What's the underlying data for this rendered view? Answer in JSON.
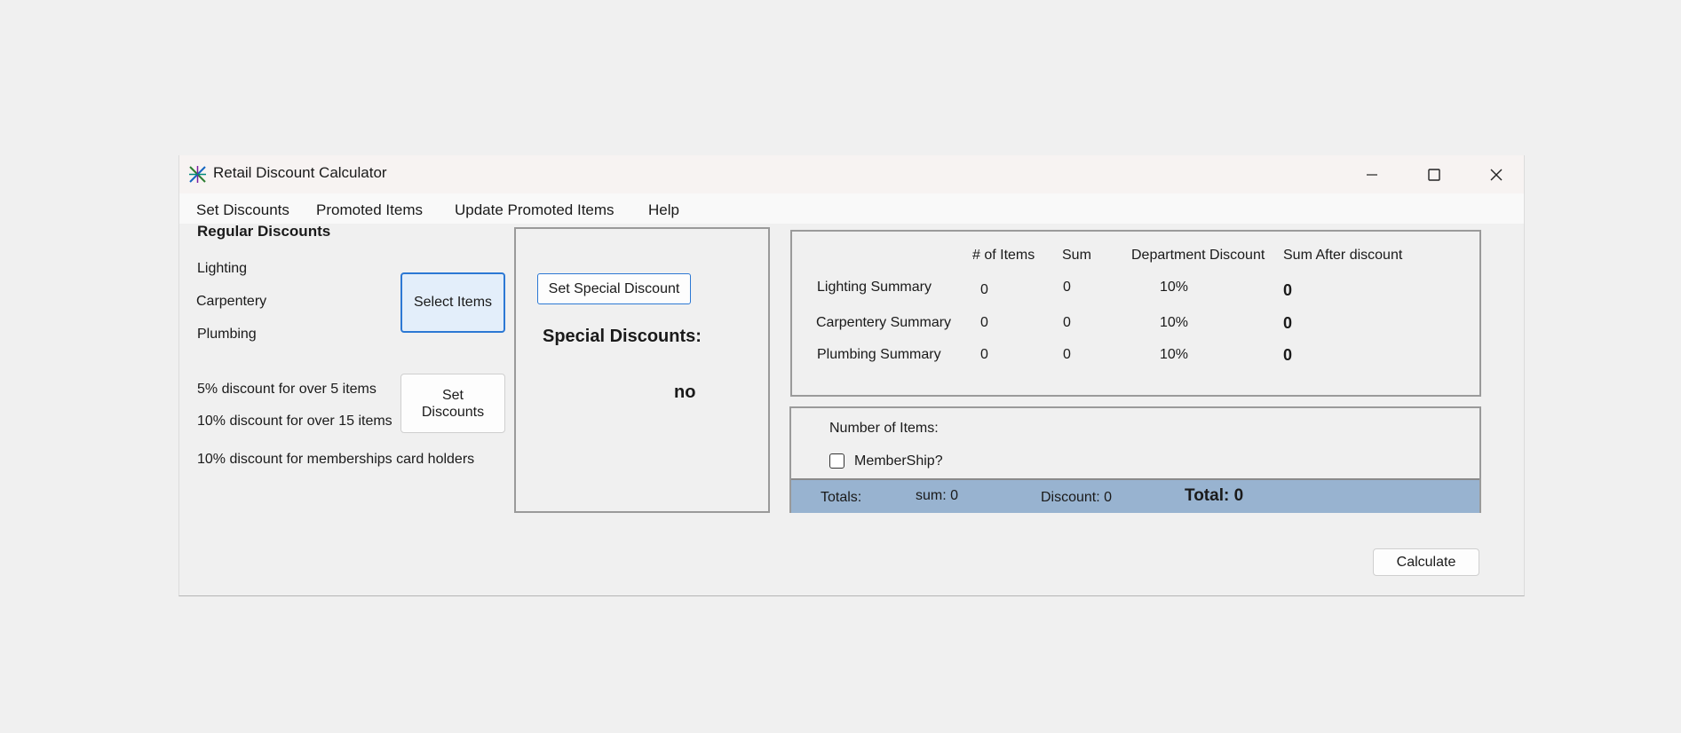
{
  "window": {
    "title": "Retail Discount Calculator"
  },
  "menu": [
    "Set Discounts",
    "Promoted Items",
    "Update Promoted Items",
    "Help"
  ],
  "regular": {
    "heading": "Regular Discounts",
    "departments": [
      "Lighting",
      "Carpentery",
      "Plumbing"
    ],
    "select_button": "Select Items",
    "rule_5": "5% discount for over 5 items",
    "rule_10": "10% discount for over 15 items",
    "rule_member": "10% discount for memberships card holders",
    "set_discounts_button": "Set Discounts"
  },
  "special": {
    "button": "Set Special Discount",
    "heading": "Special Discounts:",
    "value": "no"
  },
  "summary": {
    "headers": [
      "# of Items",
      "Sum",
      "Department Discount",
      "Sum After discount"
    ],
    "rows": [
      {
        "label": "Lighting Summary",
        "items": "0",
        "sum": "0",
        "discount": "10%",
        "after": "0"
      },
      {
        "label": "Carpentery Summary",
        "items": "0",
        "sum": "0",
        "discount": "10%",
        "after": "0"
      },
      {
        "label": "Plumbing Summary",
        "items": "0",
        "sum": "0",
        "discount": "10%",
        "after": "0"
      }
    ]
  },
  "items_panel": {
    "number_label": "Number of Items:",
    "membership_label": "MemberShip?",
    "membership_checked": false
  },
  "totals": {
    "label": "Totals:",
    "sum": "sum: 0",
    "discount": "Discount: 0",
    "total": "Total: 0"
  },
  "calculate_button": "Calculate",
  "colors": {
    "totals_bar": "#98b3d0",
    "focus_border": "#2c78d4"
  }
}
